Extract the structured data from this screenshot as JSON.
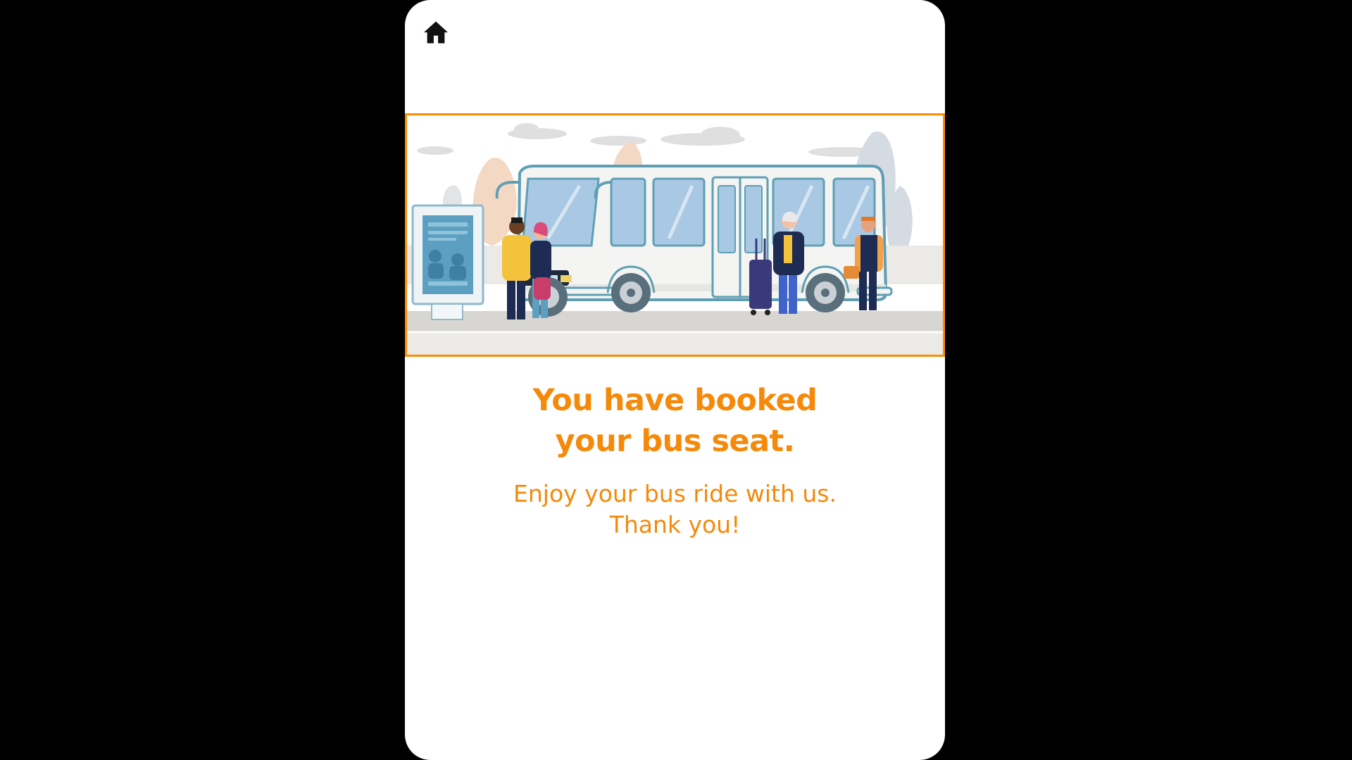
{
  "app": {
    "home_icon": "home-icon",
    "accent_color": "#f5890a",
    "frame_color": "#ff8c00"
  },
  "confirmation": {
    "title_line1": "You have booked",
    "title_line2": "your bus seat.",
    "message_line1": "Enjoy your bus ride with us.",
    "message_line2": "Thank you!"
  },
  "illustration": {
    "subject": "bus-stop-illustration"
  }
}
